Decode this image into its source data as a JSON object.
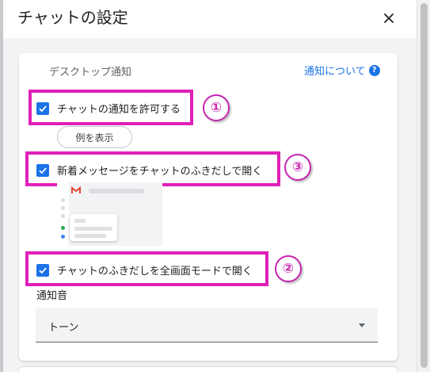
{
  "dialog": {
    "title": "チャットの設定",
    "close_icon": "close-icon"
  },
  "section": {
    "title": "デスクトップ通知",
    "help_link": "通知について",
    "help_icon": "?"
  },
  "options": [
    {
      "label": "チャットの通知を許可する",
      "checked": true
    },
    {
      "label": "新着メッセージをチャットのふきだしで開く",
      "checked": true
    },
    {
      "label": "チャットのふきだしを全画面モードで開く",
      "checked": true
    }
  ],
  "example_button": "例を表示",
  "annotations": [
    "①",
    "③",
    "②"
  ],
  "sound": {
    "label": "通知音",
    "selected": "トーン"
  },
  "colors": {
    "accent": "#1a73e8",
    "highlight": "#e020b8",
    "annotation": "#c724b1"
  }
}
